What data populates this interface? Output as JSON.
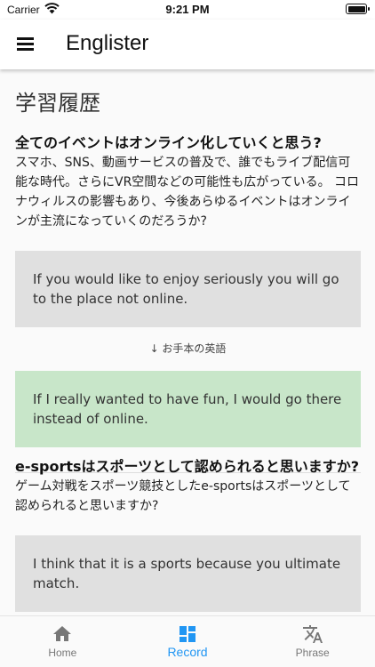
{
  "status_bar": {
    "carrier": "Carrier",
    "time": "9:21 PM"
  },
  "app_bar": {
    "title": "Englister"
  },
  "main": {
    "section_title": "学習履歴",
    "entries": [
      {
        "question": "全てのイベントはオンライン化していくと思う?",
        "description": "スマホ、SNS、動画サービスの普及で、誰でもライブ配信可能な時代。さらにVR空間などの可能性も広がっている。 コロナウィルスの影響もあり、今後あらゆるイベントはオンラインが主流になっていくのだろうか?",
        "user_answer": "If you would like to enjoy seriously you will go to the place not online.",
        "model_label": "↓ お手本の英語",
        "model_answer": "If I really wanted to have fun, I would go there instead of online."
      },
      {
        "question": "e-sportsはスポーツとして認められると思いますか?",
        "description": "ゲーム対戦をスポーツ競技としたe-sportsはスポーツとして認められると思いますか?",
        "user_answer": "I think that it is a sports because you ultimate match."
      }
    ]
  },
  "bottom_nav": {
    "items": [
      {
        "label": "Home",
        "icon": "home-icon"
      },
      {
        "label": "Record",
        "icon": "dashboard-icon"
      },
      {
        "label": "Phrase",
        "icon": "translate-icon"
      }
    ],
    "active": "Record",
    "accent_color": "#2196f3",
    "inactive_color": "#777777"
  }
}
